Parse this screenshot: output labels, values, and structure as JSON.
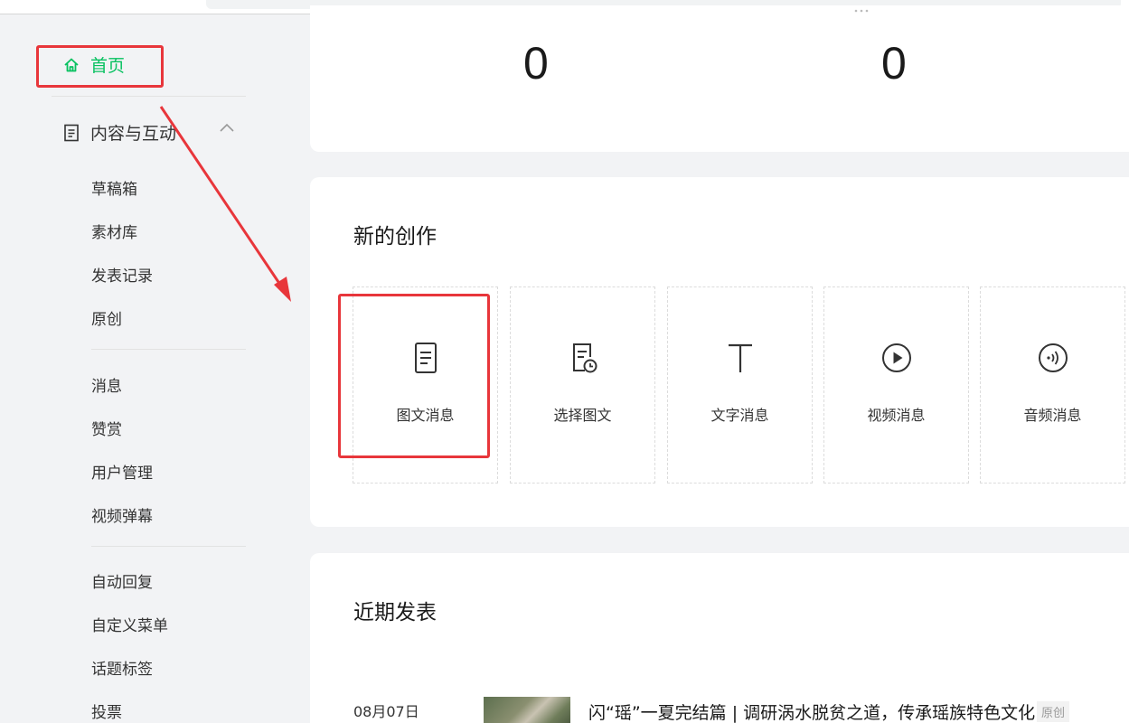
{
  "sidebar": {
    "home_label": "首页",
    "group_label": "内容与互动",
    "items_group1": [
      "草稿箱",
      "素材库",
      "发表记录",
      "原创"
    ],
    "items_group2": [
      "消息",
      "赞赏",
      "用户管理",
      "视频弹幕"
    ],
    "items_group3": [
      "自动回复",
      "自定义菜单",
      "话题标签",
      "投票"
    ]
  },
  "stats": {
    "value_1": "0",
    "value_2": "0"
  },
  "create": {
    "title": "新的创作",
    "tiles": [
      {
        "label": "图文消息",
        "icon": "document-icon"
      },
      {
        "label": "选择图文",
        "icon": "document-clock-icon"
      },
      {
        "label": "文字消息",
        "icon": "text-t-icon"
      },
      {
        "label": "视频消息",
        "icon": "play-circle-icon"
      },
      {
        "label": "音频消息",
        "icon": "audio-wave-icon"
      }
    ]
  },
  "recent": {
    "title": "近期发表",
    "posts": [
      {
        "date": "08月07日",
        "title": "闪“瑶”一夏完结篇 | 调研涡水脱贫之道，传承瑶族特色文化",
        "badge": "原创"
      }
    ]
  },
  "colors": {
    "accent": "#07c160",
    "annotation": "#e8363b"
  }
}
